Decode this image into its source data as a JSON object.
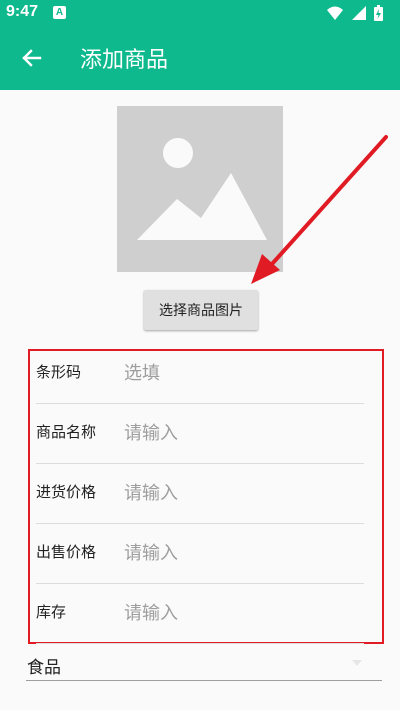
{
  "status_bar": {
    "time": "9:47",
    "notification_icon": "A",
    "icons": [
      "wifi-icon",
      "signal-icon",
      "battery-charging-icon"
    ]
  },
  "app_bar": {
    "back_icon": "arrow-left-icon",
    "title": "添加商品"
  },
  "product_image": {
    "icon": "image-placeholder-icon"
  },
  "select_image_button": {
    "label": "选择商品图片"
  },
  "form": {
    "barcode": {
      "label": "条形码",
      "placeholder": "选填"
    },
    "name": {
      "label": "商品名称",
      "placeholder": "请输入"
    },
    "purchase_price": {
      "label": "进货价格",
      "placeholder": "请输入"
    },
    "sale_price": {
      "label": "出售价格",
      "placeholder": "请输入"
    },
    "stock": {
      "label": "库存",
      "placeholder": "请输入"
    }
  },
  "category": {
    "selected": "食品",
    "icon": "dropdown-triangle-icon"
  },
  "colors": {
    "primary": "#0fb98e",
    "annotation": "#e01b24"
  }
}
